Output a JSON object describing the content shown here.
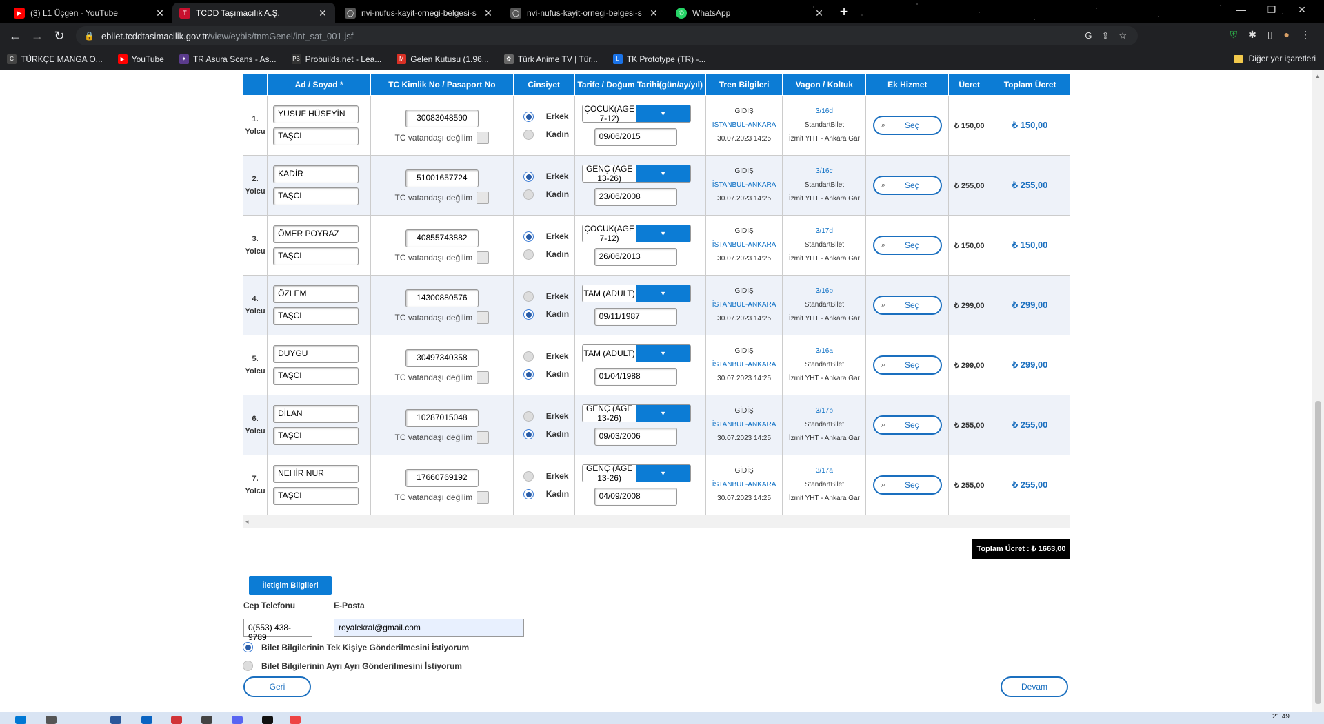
{
  "browser": {
    "tabs": [
      {
        "title": "(3) L1 Üçgen - YouTube",
        "fav": "youtube",
        "color": "#ff0000"
      },
      {
        "title": "TCDD Taşımacılık A.Ş.",
        "fav": "tcdd",
        "color": "#c8102e"
      },
      {
        "title": "nvi-nufus-kayit-ornegi-belgesi-s",
        "fav": "globe",
        "color": "#777777"
      },
      {
        "title": "nvi-nufus-kayit-ornegi-belgesi-s",
        "fav": "globe",
        "color": "#777777"
      },
      {
        "title": "WhatsApp",
        "fav": "whatsapp",
        "color": "#25d366"
      }
    ],
    "url_host": "ebilet.tcddtasimacilik.gov.tr",
    "url_path": "/view/eybis/tnmGenel/int_sat_001.jsf",
    "bookmarks": [
      {
        "label": "TÜRKÇE MANGA O...",
        "color": "#444444"
      },
      {
        "label": "YouTube",
        "color": "#ff0000"
      },
      {
        "label": "TR Asura Scans - As...",
        "color": "#5a3b8c"
      },
      {
        "label": "Probuilds.net - Lea...",
        "color": "#333333"
      },
      {
        "label": "Gelen Kutusu (1.96...",
        "color": "#d93025"
      },
      {
        "label": "Türk Anime TV | Tür...",
        "color": "#666666"
      },
      {
        "label": "TK Prototype (TR) -...",
        "color": "#1a73e8"
      }
    ],
    "other_bookmarks": "Diğer yer işaretleri"
  },
  "table": {
    "headers": [
      "Ad / Soyad *",
      "TC Kimlik No / Pasaport No",
      "Cinsiyet",
      "Tarife / Doğum Tarihi(gün/ay/yıl)",
      "Tren Bilgileri",
      "Vagon / Koltuk",
      "Ek Hizmet",
      "Ücret",
      "Toplam Ücret"
    ],
    "yolcu_label": "Yolcu",
    "tc_not_label": "TC vatandaşı değilim",
    "erkek": "Erkek",
    "kadin": "Kadın",
    "sec_label": "Seç",
    "passengers": [
      {
        "num": "1.",
        "first": "YUSUF HÜSEYİN",
        "last": "TAŞCI",
        "tc": "30083048590",
        "sex": "Erkek",
        "tarife": "ÇOCUK(AGE 7-12)",
        "dob": "09/06/2015",
        "dir": "GİDİŞ",
        "route": "İSTANBUL-ANKARA",
        "date": "30.07.2023 14:25",
        "seat": "3/16d",
        "class": "StandartBilet",
        "train": "İzmit YHT - Ankara Gar",
        "price": "₺ 150,00",
        "total": "₺ 150,00"
      },
      {
        "num": "2.",
        "first": "KADİR",
        "last": "TAŞCI",
        "tc": "51001657724",
        "sex": "Erkek",
        "tarife": "GENÇ (AGE 13-26)",
        "dob": "23/06/2008",
        "dir": "GİDİŞ",
        "route": "İSTANBUL-ANKARA",
        "date": "30.07.2023 14:25",
        "seat": "3/16c",
        "class": "StandartBilet",
        "train": "İzmit YHT - Ankara Gar",
        "price": "₺ 255,00",
        "total": "₺ 255,00"
      },
      {
        "num": "3.",
        "first": "ÖMER POYRAZ",
        "last": "TAŞCI",
        "tc": "40855743882",
        "sex": "Erkek",
        "tarife": "ÇOCUK(AGE 7-12)",
        "dob": "26/06/2013",
        "dir": "GİDİŞ",
        "route": "İSTANBUL-ANKARA",
        "date": "30.07.2023 14:25",
        "seat": "3/17d",
        "class": "StandartBilet",
        "train": "İzmit YHT - Ankara Gar",
        "price": "₺ 150,00",
        "total": "₺ 150,00"
      },
      {
        "num": "4.",
        "first": "ÖZLEM",
        "last": "TAŞCI",
        "tc": "14300880576",
        "sex": "Kadın",
        "tarife": "TAM (ADULT)",
        "dob": "09/11/1987",
        "dir": "GİDİŞ",
        "route": "İSTANBUL-ANKARA",
        "date": "30.07.2023 14:25",
        "seat": "3/16b",
        "class": "StandartBilet",
        "train": "İzmit YHT - Ankara Gar",
        "price": "₺ 299,00",
        "total": "₺ 299,00"
      },
      {
        "num": "5.",
        "first": "DUYGU",
        "last": "TAŞCI",
        "tc": "30497340358",
        "sex": "Kadın",
        "tarife": "TAM (ADULT)",
        "dob": "01/04/1988",
        "dir": "GİDİŞ",
        "route": "İSTANBUL-ANKARA",
        "date": "30.07.2023 14:25",
        "seat": "3/16a",
        "class": "StandartBilet",
        "train": "İzmit YHT - Ankara Gar",
        "price": "₺ 299,00",
        "total": "₺ 299,00"
      },
      {
        "num": "6.",
        "first": "DİLAN",
        "last": "TAŞCI",
        "tc": "10287015048",
        "sex": "Kadın",
        "tarife": "GENÇ (AGE 13-26)",
        "dob": "09/03/2006",
        "dir": "GİDİŞ",
        "route": "İSTANBUL-ANKARA",
        "date": "30.07.2023 14:25",
        "seat": "3/17b",
        "class": "StandartBilet",
        "train": "İzmit YHT - Ankara Gar",
        "price": "₺ 255,00",
        "total": "₺ 255,00"
      },
      {
        "num": "7.",
        "first": "NEHİR NUR",
        "last": "TAŞCI",
        "tc": "17660769192",
        "sex": "Kadın",
        "tarife": "GENÇ (AGE 13-26)",
        "dob": "04/09/2008",
        "dir": "GİDİŞ",
        "route": "İSTANBUL-ANKARA",
        "date": "30.07.2023 14:25",
        "seat": "3/17a",
        "class": "StandartBilet",
        "train": "İzmit YHT - Ankara Gar",
        "price": "₺ 255,00",
        "total": "₺ 255,00"
      }
    ]
  },
  "total_label": "Toplam Ücret : ₺ 1663,00",
  "contact": {
    "header": "İletişim Bilgileri",
    "phone_label": "Cep Telefonu",
    "email_label": "E-Posta",
    "phone": "0(553) 438-9789",
    "email": "royalekral@gmail.com",
    "opt1": "Bilet Bilgilerinin Tek Kişiye Gönderilmesini İstiyorum",
    "opt2": "Bilet Bilgilerinin Ayrı Ayrı Gönderilmesini İstiyorum"
  },
  "buttons": {
    "back": "Geri",
    "next": "Devam"
  },
  "clock": "21:49",
  "colors": {
    "accent": "#0c7cd5",
    "link": "#1a6fbf"
  }
}
